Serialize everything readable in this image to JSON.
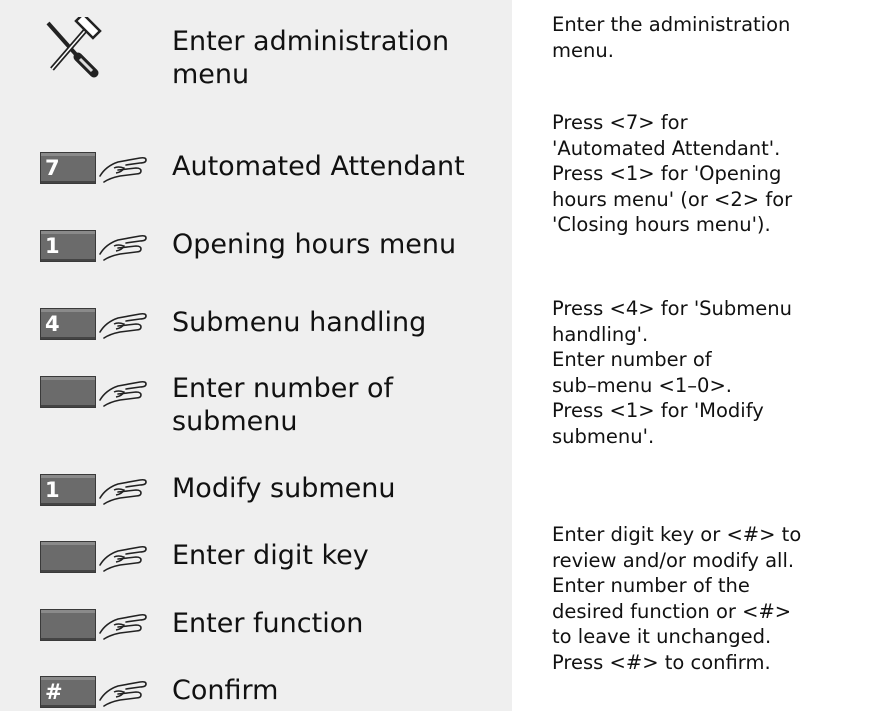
{
  "steps": [
    {
      "key": "",
      "icon": "tools-icon",
      "label": "Enter administration\nmenu"
    },
    {
      "key": "7",
      "icon": "pointing-hand-icon",
      "label": "Automated Attendant"
    },
    {
      "key": "1",
      "icon": "pointing-hand-icon",
      "label": "Opening hours menu"
    },
    {
      "key": "4",
      "icon": "pointing-hand-icon",
      "label": "Submenu handling"
    },
    {
      "key": "",
      "icon": "pointing-hand-icon",
      "label": "Enter number of\nsubmenu"
    },
    {
      "key": "1",
      "icon": "pointing-hand-icon",
      "label": "Modify submenu"
    },
    {
      "key": "",
      "icon": "pointing-hand-icon",
      "label": "Enter digit key"
    },
    {
      "key": "",
      "icon": "pointing-hand-icon",
      "label": "Enter function"
    },
    {
      "key": "#",
      "icon": "pointing-hand-icon",
      "label": "Confirm"
    }
  ],
  "descriptions": [
    "Enter the administration\nmenu.",
    "Press <7> for\n'Automated Attendant'.\nPress <1> for 'Opening\nhours menu' (or <2> for\n'Closing hours menu').",
    "Press <4> for 'Submenu\nhandling'.\nEnter number of\nsub–menu <1–0>.\nPress <1> for 'Modify\nsubmenu'.",
    "Enter digit key or <#> to\nreview and/or modify all.\nEnter number of the\ndesired function or <#>\nto leave it unchanged.\nPress <#> to confirm."
  ]
}
